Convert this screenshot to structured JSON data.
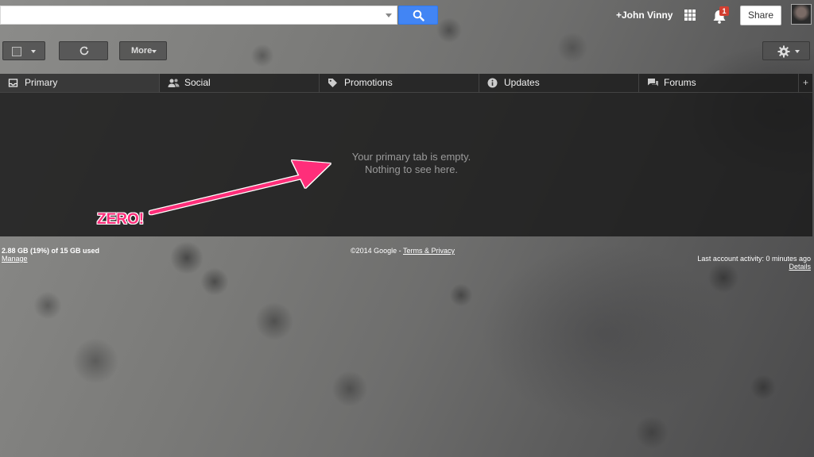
{
  "header": {
    "search_value": "",
    "user_name": "+John Vinny",
    "notification_count": "1",
    "share_label": "Share"
  },
  "toolbar": {
    "more_label": "More"
  },
  "tabs": [
    {
      "label": "Primary",
      "icon": "inbox-icon",
      "active": true
    },
    {
      "label": "Social",
      "icon": "people-icon",
      "active": false
    },
    {
      "label": "Promotions",
      "icon": "tag-icon",
      "active": false
    },
    {
      "label": "Updates",
      "icon": "info-icon",
      "active": false
    },
    {
      "label": "Forums",
      "icon": "chat-icon",
      "active": false
    }
  ],
  "tab_add_label": "+",
  "empty_state": {
    "line1": "Your primary tab is empty.",
    "line2": "Nothing to see here."
  },
  "annotation": {
    "label": "ZERO!",
    "color": "#ff2e7a"
  },
  "footer": {
    "storage": "2.88 GB (19%) of 15 GB used",
    "manage": "Manage",
    "copyright": "©2014 Google - ",
    "terms_link": "Terms & Privacy",
    "activity": "Last account activity: 0 minutes ago",
    "details": "Details"
  },
  "colors": {
    "search_blue": "#4285f4",
    "badge_red": "#d23f31"
  }
}
